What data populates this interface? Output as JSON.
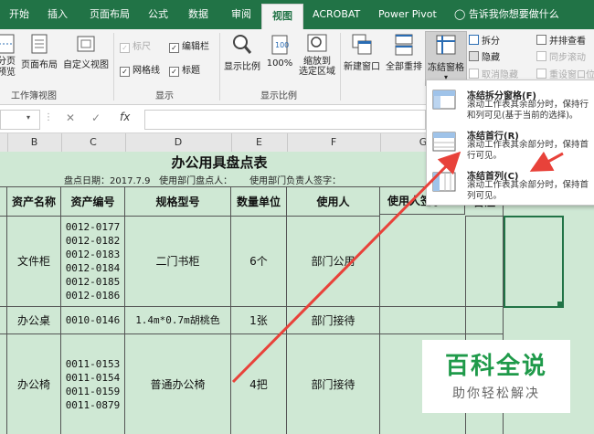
{
  "ribbon_tabs": [
    "开始",
    "插入",
    "页面布局",
    "公式",
    "数据",
    "审阅",
    "视图",
    "ACROBAT",
    "Power Pivot"
  ],
  "active_tab": "视图",
  "tell_me": "告诉我你想要做什么",
  "ribbon": {
    "workbook_views": {
      "page_break": "分页\n预览",
      "page_layout": "页面布局",
      "custom_views": "自定义视图",
      "group_label": "工作簿视图"
    },
    "show": {
      "ruler": "标尺",
      "formula_bar": "编辑栏",
      "gridlines": "网格线",
      "headings": "标题",
      "group_label": "显示"
    },
    "zoom": {
      "zoom": "显示比例",
      "zoom_100": "100%",
      "zoom_selection": "缩放到\n选定区域",
      "group_label": "显示比例"
    },
    "window": {
      "new_window": "新建窗口",
      "arrange_all": "全部重排",
      "freeze_panes": "冻结窗格",
      "split": "拆分",
      "hide": "隐藏",
      "unhide": "取消隐藏",
      "view_side": "并排查看",
      "sync_scroll": "同步滚动",
      "reset_pos": "重设窗口位"
    }
  },
  "formula_bar": {
    "fx": "fx"
  },
  "col_headers": [
    "B",
    "C",
    "D",
    "E",
    "F",
    "G"
  ],
  "freeze_menu": [
    {
      "title": "冻结拆分窗格(F)",
      "desc": "滚动工作表其余部分时，保持行和列可见(基于当前的选择)。"
    },
    {
      "title": "冻结首行(R)",
      "desc": "滚动工作表其余部分时，保持首行可见。"
    },
    {
      "title": "冻结首列(C)",
      "desc": "滚动工作表其余部分时，保持首列可见。"
    }
  ],
  "sheet": {
    "title": "办公用具盘点表",
    "subtitle": "盘点日期：2017.7.9   使用部门盘点人：      使用部门负责人签字：",
    "headers": [
      "资产名称",
      "资产编号",
      "规格型号",
      "数量单位",
      "使用人",
      "使用人签字",
      "备注"
    ],
    "rows": [
      {
        "name": "文件柜",
        "codes": "0012-0177\n0012-0182\n0012-0183\n0012-0184\n0012-0185\n0012-0186",
        "spec": "二门书柜",
        "qty": "6个",
        "user": "部门公用"
      },
      {
        "name": "办公桌",
        "codes": "0010-0146",
        "spec": "1.4m*0.7m胡桃色",
        "qty": "1张",
        "user": "部门接待"
      },
      {
        "name": "办公椅",
        "codes": "0011-0153\n0011-0154\n0011-0159\n0011-0879",
        "spec": "普通办公椅",
        "qty": "4把",
        "user": "部门接待"
      }
    ]
  },
  "watermark": {
    "title": "百科全说",
    "subtitle": "助你轻松解决"
  },
  "colors": {
    "excel_green": "#217346",
    "sheet_fill": "#cfe8d4",
    "arrow": "#e8423a"
  }
}
